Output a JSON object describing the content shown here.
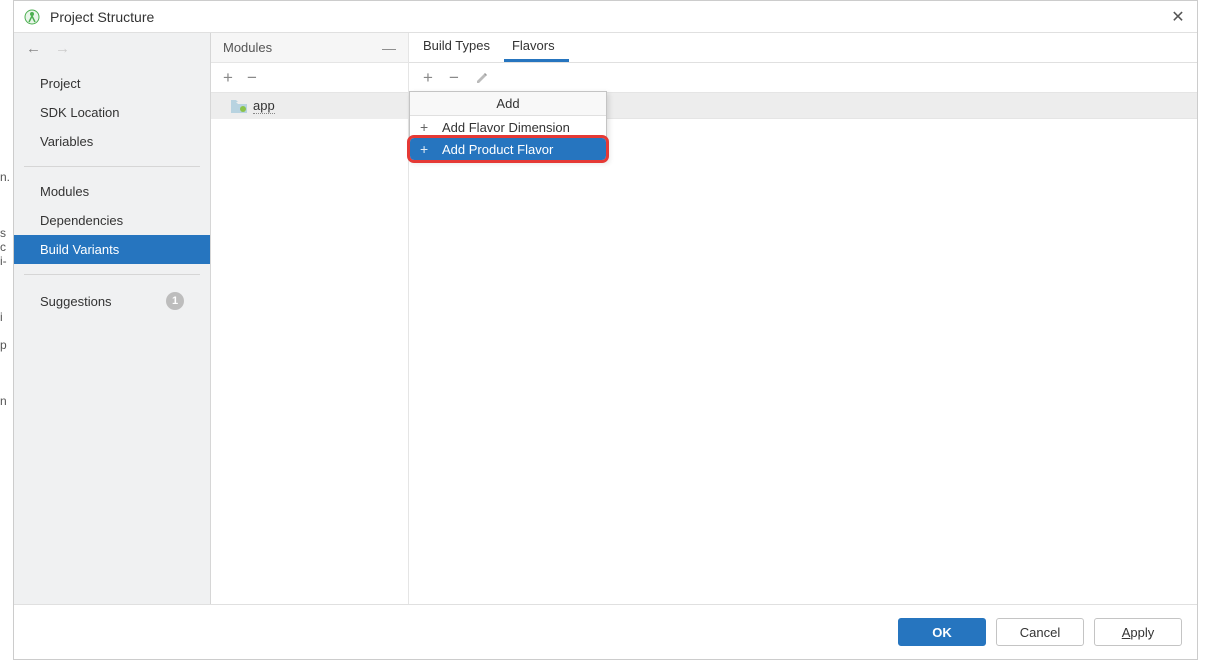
{
  "window": {
    "title": "Project Structure"
  },
  "sidebar": {
    "items": [
      {
        "label": "Project"
      },
      {
        "label": "SDK Location"
      },
      {
        "label": "Variables"
      },
      {
        "label": "Modules"
      },
      {
        "label": "Dependencies"
      },
      {
        "label": "Build Variants",
        "selected": true
      },
      {
        "label": "Suggestions",
        "badge": "1"
      }
    ]
  },
  "modules": {
    "title": "Modules",
    "items": [
      {
        "label": "app"
      }
    ]
  },
  "tabs": {
    "items": [
      {
        "label": "Build Types"
      },
      {
        "label": "Flavors",
        "active": true
      }
    ]
  },
  "add_popup": {
    "title": "Add",
    "items": [
      {
        "label": "Add Flavor Dimension"
      },
      {
        "label": "Add Product Flavor",
        "selected": true,
        "highlighted": true
      }
    ]
  },
  "footer": {
    "ok": "OK",
    "cancel": "Cancel",
    "apply": "Apply",
    "apply_underline": "A",
    "apply_rest": "pply"
  }
}
